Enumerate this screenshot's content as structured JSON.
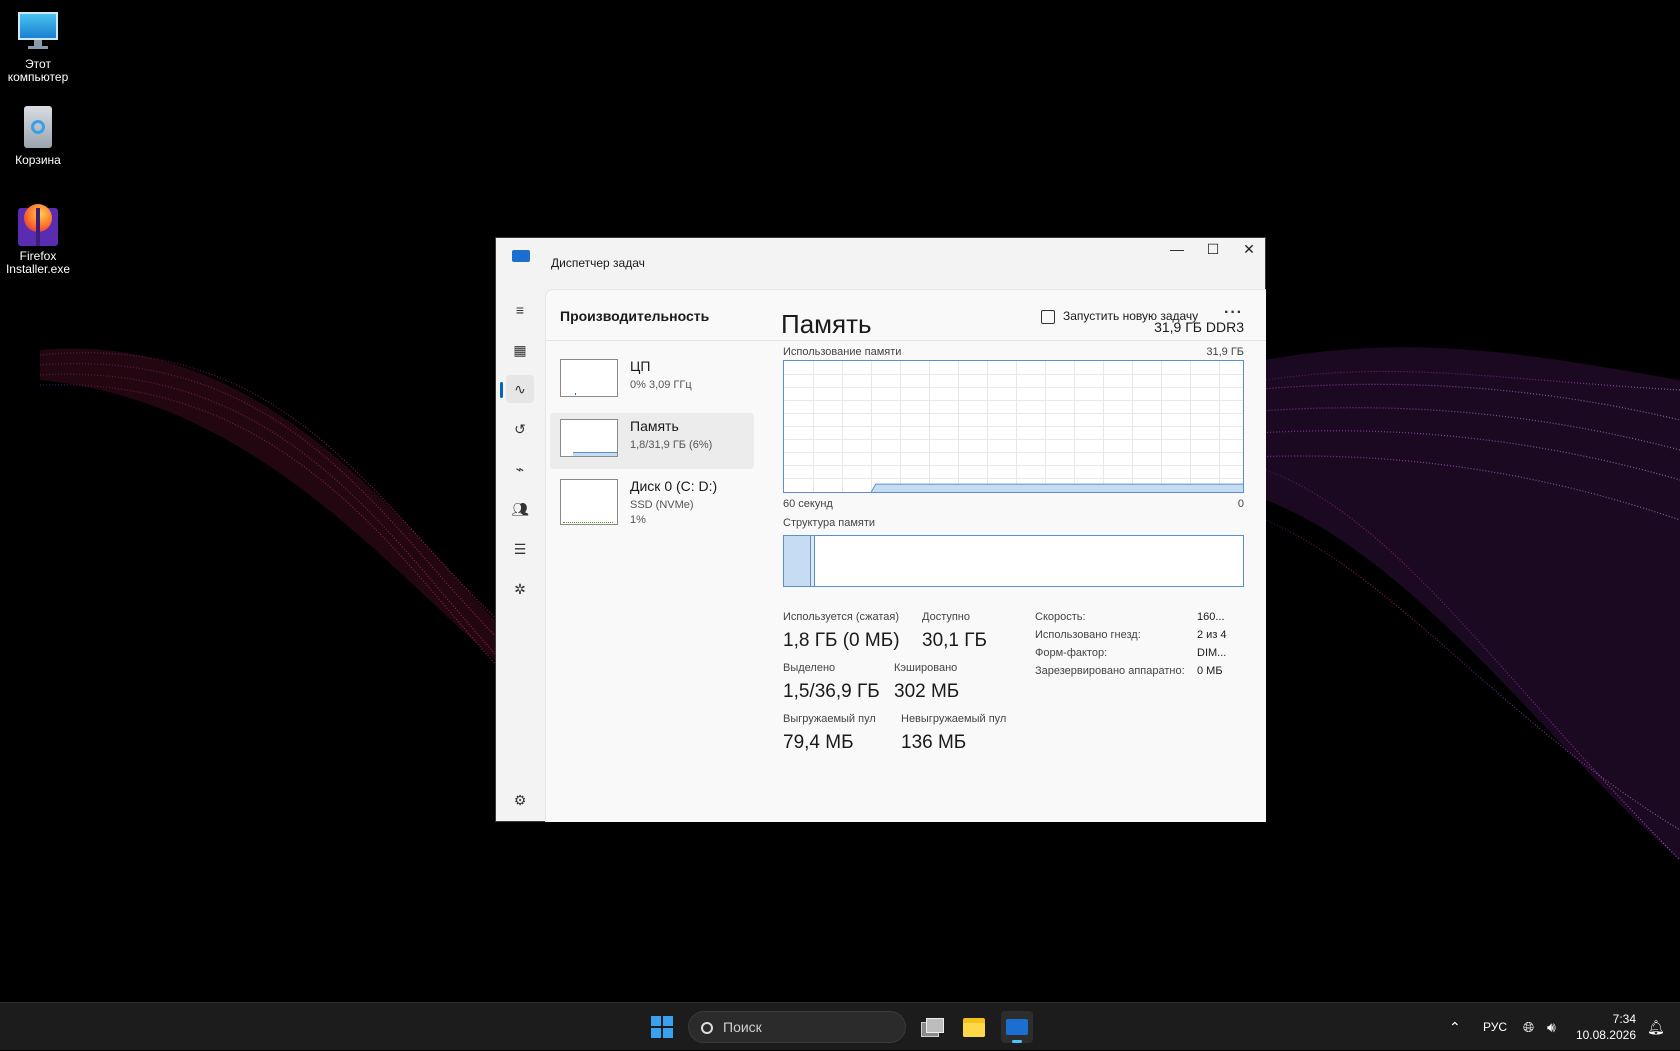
{
  "desktop": {
    "icons": [
      {
        "label": "Этот компьютер"
      },
      {
        "label": "Корзина"
      },
      {
        "label": "Firefox Installer.exe"
      }
    ]
  },
  "window": {
    "title": "Диспетчер задач",
    "controls": {
      "minimize": "—",
      "maximize": "☐",
      "close": "✕"
    }
  },
  "sidebar": {
    "items": [
      {
        "icon": "hamburger-icon"
      },
      {
        "icon": "processes-icon"
      },
      {
        "icon": "performance-icon",
        "active": true
      },
      {
        "icon": "app-history-icon"
      },
      {
        "icon": "startup-apps-icon"
      },
      {
        "icon": "users-icon"
      },
      {
        "icon": "details-icon"
      },
      {
        "icon": "services-icon"
      },
      {
        "icon": "settings-icon"
      }
    ]
  },
  "header": {
    "title": "Производительность",
    "run_task": "Запустить новую задачу",
    "more": "···"
  },
  "resources": [
    {
      "name": "ЦП",
      "sub1": "0% 3,09 ГГц",
      "sub2": ""
    },
    {
      "name": "Память",
      "sub1": "1,8/31,9 ГБ (6%)",
      "sub2": ""
    },
    {
      "name": "Диск 0 (C: D:)",
      "sub1": "SSD (NVMe)",
      "sub2": "1%"
    }
  ],
  "memory": {
    "title": "Память",
    "capacity": "31,9 ГБ DDR3",
    "usage_label": "Использование памяти",
    "usage_max": "31,9 ГБ",
    "time_left": "60 секунд",
    "time_right": "0",
    "usage_fraction": 0.06,
    "structure_label": "Структура памяти",
    "stats": {
      "in_use_label": "Используется (сжатая)",
      "in_use": "1,8 ГБ (0 МБ)",
      "available_label": "Доступно",
      "available": "30,1 ГБ",
      "committed_label": "Выделено",
      "committed": "1,5/36,9 ГБ",
      "cached_label": "Кэшировано",
      "cached": "302 МБ",
      "paged_label": "Выгружаемый пул",
      "paged": "79,4 МБ",
      "nonpaged_label": "Невыгружаемый пул",
      "nonpaged": "136 МБ"
    },
    "details": [
      {
        "k": "Скорость:",
        "v": "160..."
      },
      {
        "k": "Использовано гнезд:",
        "v": "2 из 4"
      },
      {
        "k": "Форм-фактор:",
        "v": "DIM..."
      },
      {
        "k": "Зарезервировано аппаратно:",
        "v": "0 МБ"
      }
    ]
  },
  "taskbar": {
    "search_placeholder": "Поиск",
    "lang": "РУС",
    "time": "7:34",
    "date": "10.08.2026"
  }
}
